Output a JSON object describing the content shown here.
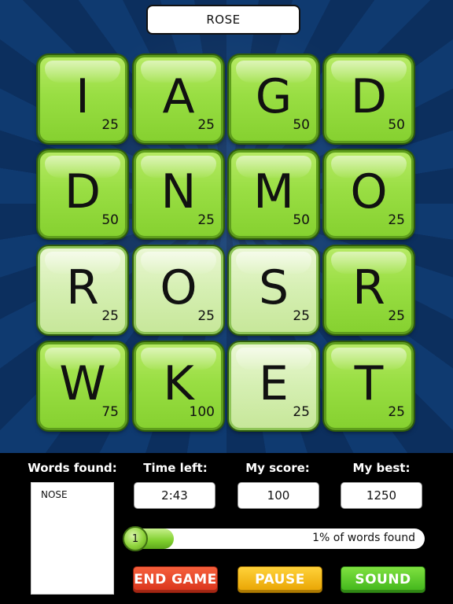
{
  "current_word": "ROSE",
  "tiles": [
    {
      "letter": "I",
      "points": "25",
      "selected": false
    },
    {
      "letter": "A",
      "points": "25",
      "selected": false
    },
    {
      "letter": "G",
      "points": "50",
      "selected": false
    },
    {
      "letter": "D",
      "points": "50",
      "selected": false
    },
    {
      "letter": "D",
      "points": "50",
      "selected": false
    },
    {
      "letter": "N",
      "points": "25",
      "selected": false
    },
    {
      "letter": "M",
      "points": "50",
      "selected": false
    },
    {
      "letter": "O",
      "points": "25",
      "selected": false
    },
    {
      "letter": "R",
      "points": "25",
      "selected": true
    },
    {
      "letter": "O",
      "points": "25",
      "selected": true
    },
    {
      "letter": "S",
      "points": "25",
      "selected": true
    },
    {
      "letter": "R",
      "points": "25",
      "selected": false
    },
    {
      "letter": "W",
      "points": "75",
      "selected": false
    },
    {
      "letter": "K",
      "points": "100",
      "selected": false
    },
    {
      "letter": "E",
      "points": "25",
      "selected": true
    },
    {
      "letter": "T",
      "points": "25",
      "selected": false
    }
  ],
  "panel": {
    "words_found_label": "Words found:",
    "words_found": [
      "NOSE"
    ],
    "time_left_label": "Time left:",
    "time_left": "2:43",
    "my_score_label": "My score:",
    "my_score": "100",
    "my_best_label": "My best:",
    "my_best": "1250"
  },
  "progress": {
    "words_count": "1",
    "percent_text": "1% of words found",
    "fill_fraction": 0.16
  },
  "buttons": {
    "end_game": "END GAME",
    "pause": "PAUSE",
    "sound": "SOUND"
  }
}
